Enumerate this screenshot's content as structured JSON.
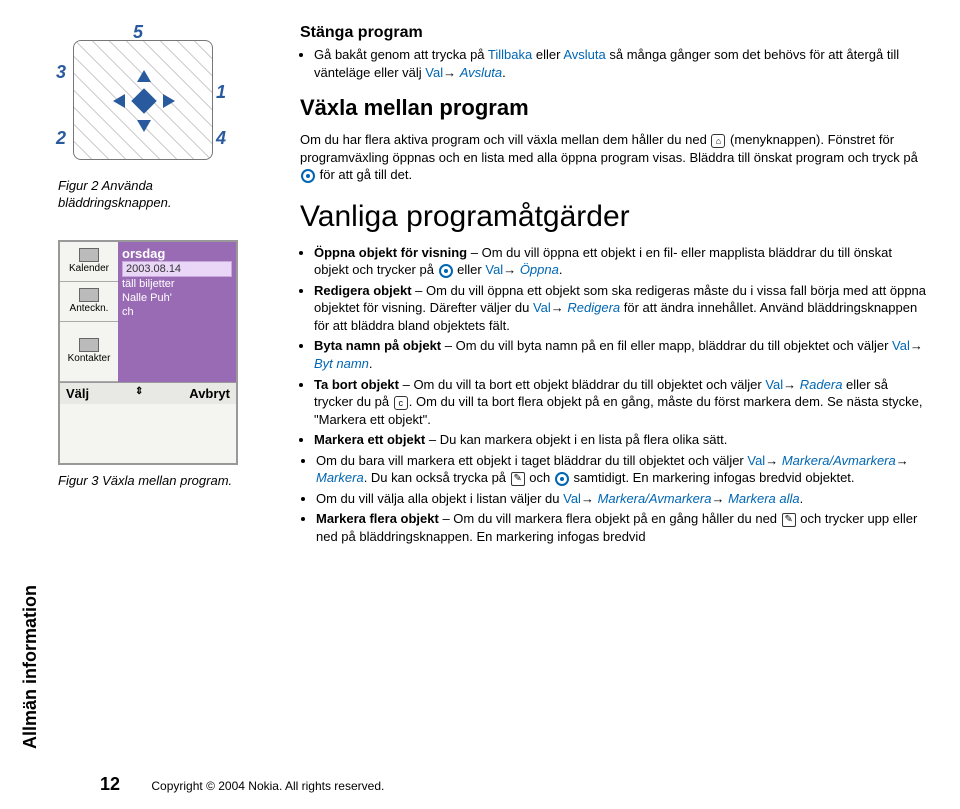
{
  "vertical_label": "Allmän information",
  "fig2": {
    "n1": "1",
    "n2": "2",
    "n3": "3",
    "n4": "4",
    "n5": "5",
    "caption": "Figur 2 Använda bläddringsknappen."
  },
  "fig3": {
    "side": {
      "kalender": "Kalender",
      "anteckn": "Anteckn.",
      "kontakter": "Kontakter"
    },
    "main": {
      "header": "orsdag",
      "date": "2003.08.14",
      "r1": "täll biljetter",
      "r2": "Nalle Puh'",
      "r3": "ch"
    },
    "bottom": {
      "left": "Välj",
      "mid": "⇕",
      "right": "Avbryt"
    },
    "caption": "Figur 3 Växla mellan program."
  },
  "close_program": {
    "heading": "Stänga program",
    "bullet_pre": "Gå bakåt genom att trycka på ",
    "tillbaka": "Tillbaka",
    "bullet_mid1": " eller ",
    "avsluta1": "Avsluta",
    "bullet_mid2": " så många gånger som det behövs för att återgå till vänteläge eller välj ",
    "val": "Val",
    "arrow": "→ ",
    "avsluta2": "Avsluta",
    "dot": "."
  },
  "switch": {
    "heading": "Växla mellan program",
    "p1a": "Om du har flera aktiva program och vill växla mellan dem håller du ned ",
    "p1b": " (menyknappen). Fönstret för programväxling öppnas och en lista med alla öppna program visas. Bläddra till önskat program och tryck på ",
    "p1c": " för att gå till det."
  },
  "common": {
    "heading": "Vanliga programåtgärder",
    "open_b": "Öppna objekt för visning",
    "open_t1": " – Om du vill öppna ett objekt i en fil- eller mapplista bläddrar du till önskat objekt och trycker på ",
    "open_t2": " eller ",
    "val": "Val",
    "arrow": "→ ",
    "oppna": "Öppna",
    "dot": ".",
    "edit_b": "Redigera objekt",
    "edit_t1": " – Om du vill öppna ett objekt som ska redigeras måste du i vissa fall börja med att öppna objektet för visning. Därefter väljer du ",
    "redigera": "Redigera",
    "edit_t2": " för att ändra innehållet. Använd bläddringsknappen för att bläddra bland objektets fält.",
    "rename_b": "Byta namn på objekt",
    "rename_t1": " – Om du vill byta namn på en fil eller mapp, bläddrar du till objektet och väljer ",
    "bytnamn": "Byt namn",
    "del_b": "Ta bort objekt",
    "del_t1": " – Om du vill ta bort ett objekt bläddrar du till objektet och väljer ",
    "radera": "Radera",
    "del_t2": " eller så trycker du på ",
    "del_t3": ". Om du vill ta bort flera objekt på en gång, måste du först markera dem. Se nästa stycke, \"Markera ett objekt\".",
    "mark1_b": "Markera ett objekt",
    "mark1_t": " – Du kan markera objekt i en lista på flera olika sätt.",
    "mark2_t1": "Om du bara vill markera ett objekt i taget bläddrar du till objektet och väljer ",
    "markav": "Markera/Avmarkera",
    "markera": "Markera",
    "mark2_t2": ". Du kan också trycka på ",
    "mark2_t3": " och ",
    "mark2_t4": " samtidigt. En markering infogas bredvid objektet.",
    "mark3_t1": "Om du vill välja alla objekt i listan väljer du ",
    "markalla": "Markera alla",
    "mark4_b": "Markera flera objekt",
    "mark4_t1": " – Om du vill markera flera objekt på en gång håller du ned ",
    "mark4_t2": " och trycker upp eller ned på bläddringsknappen. En markering infogas bredvid"
  },
  "footer": {
    "page": "12",
    "copy": "Copyright © 2004 Nokia. All rights reserved."
  }
}
